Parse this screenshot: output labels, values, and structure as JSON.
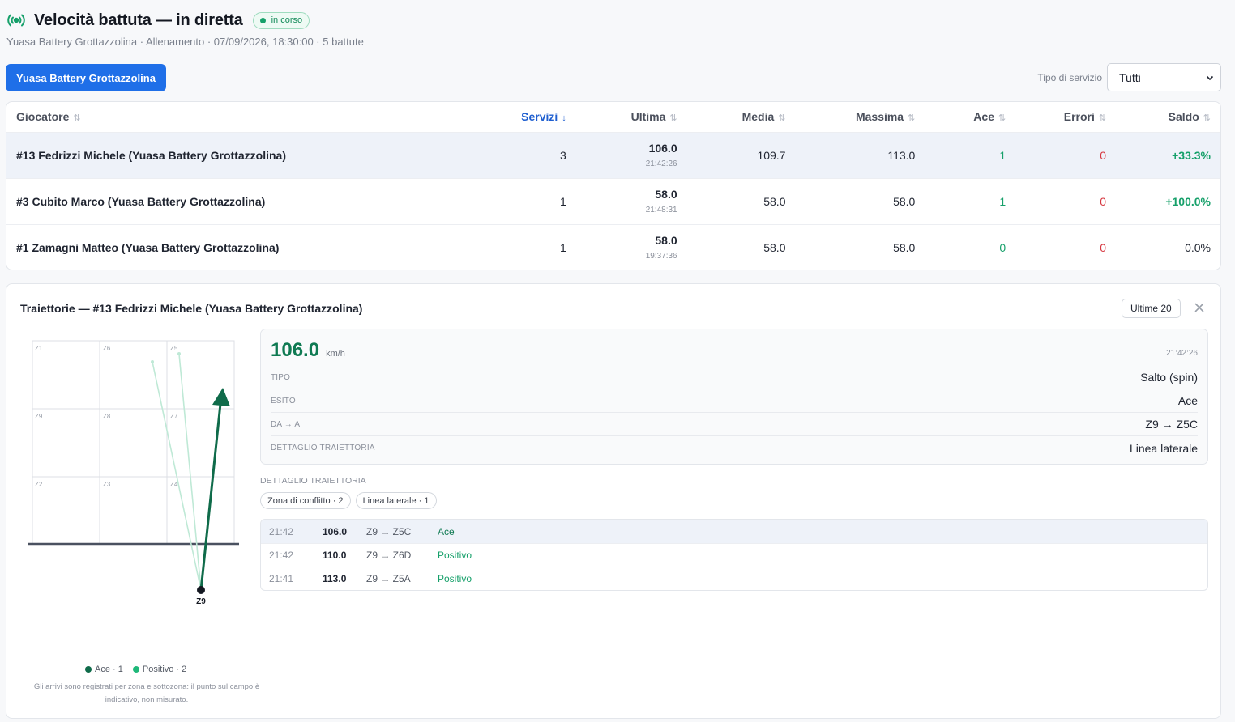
{
  "header": {
    "title": "Velocità battuta — in diretta",
    "status": "in corso",
    "subtitle": "Yuasa Battery Grottazzolina · Allenamento · 07/09/2026, 18:30:00 · 5 battute"
  },
  "toolbar": {
    "team_button": "Yuasa Battery Grottazzolina",
    "filter_label": "Tipo di servizio",
    "filter_value": "Tutti"
  },
  "table": {
    "columns": [
      "Giocatore",
      "Servizi",
      "Ultima",
      "Media",
      "Massima",
      "Ace",
      "Errori",
      "Saldo"
    ],
    "rows": [
      {
        "player": "#13 Fedrizzi Michele (Yuasa Battery Grottazzolina)",
        "servizi": "3",
        "ultima": "106.0",
        "ultima_time": "21:42:26",
        "media": "109.7",
        "massima": "113.0",
        "ace": "1",
        "errori": "0",
        "saldo": "+33.3%"
      },
      {
        "player": "#3 Cubito Marco (Yuasa Battery Grottazzolina)",
        "servizi": "1",
        "ultima": "58.0",
        "ultima_time": "21:48:31",
        "media": "58.0",
        "massima": "58.0",
        "ace": "1",
        "errori": "0",
        "saldo": "+100.0%"
      },
      {
        "player": "#1 Zamagni Matteo (Yuasa Battery Grottazzolina)",
        "servizi": "1",
        "ultima": "58.0",
        "ultima_time": "19:37:36",
        "media": "58.0",
        "massima": "58.0",
        "ace": "0",
        "errori": "0",
        "saldo": "0.0%"
      }
    ]
  },
  "trajectory": {
    "title": "Traiettorie — #13 Fedrizzi Michele (Yuasa Battery Grottazzolina)",
    "recent_button": "Ultime 20",
    "court": {
      "zones": [
        "Z1",
        "Z6",
        "Z5",
        "Z9",
        "Z8",
        "Z7",
        "Z2",
        "Z3",
        "Z4"
      ],
      "origin_label": "Z9"
    },
    "legend": [
      {
        "label": "Ace · 1",
        "color": "#0f6b4a"
      },
      {
        "label": "Positivo · 2",
        "color": "#1fb879"
      }
    ],
    "footnote": "Gli arrivi sono registrati per zona e sottozona: il punto sul campo è indicativo, non misurato.",
    "detail": {
      "speed": "106.0",
      "unit": "km/h",
      "time": "21:42:26",
      "fields": [
        {
          "key": "TIPO",
          "value": "Salto (spin)"
        },
        {
          "key": "ESITO",
          "value": "Ace"
        },
        {
          "key": "DA → A",
          "value": "Z9 → Z5C"
        },
        {
          "key": "DETTAGLIO TRAIETTORIA",
          "value": "Linea laterale"
        }
      ]
    },
    "section_label": "DETTAGLIO TRAIETTORIA",
    "chips": [
      "Zona di conflitto · 2",
      "Linea laterale · 1"
    ],
    "history": [
      {
        "time": "21:42",
        "speed": "106.0",
        "route": "Z9 → Z5C",
        "result": "Ace"
      },
      {
        "time": "21:42",
        "speed": "110.0",
        "route": "Z9 → Z6D",
        "result": "Positivo"
      },
      {
        "time": "21:41",
        "speed": "113.0",
        "route": "Z9 → Z5A",
        "result": "Positivo"
      }
    ]
  }
}
